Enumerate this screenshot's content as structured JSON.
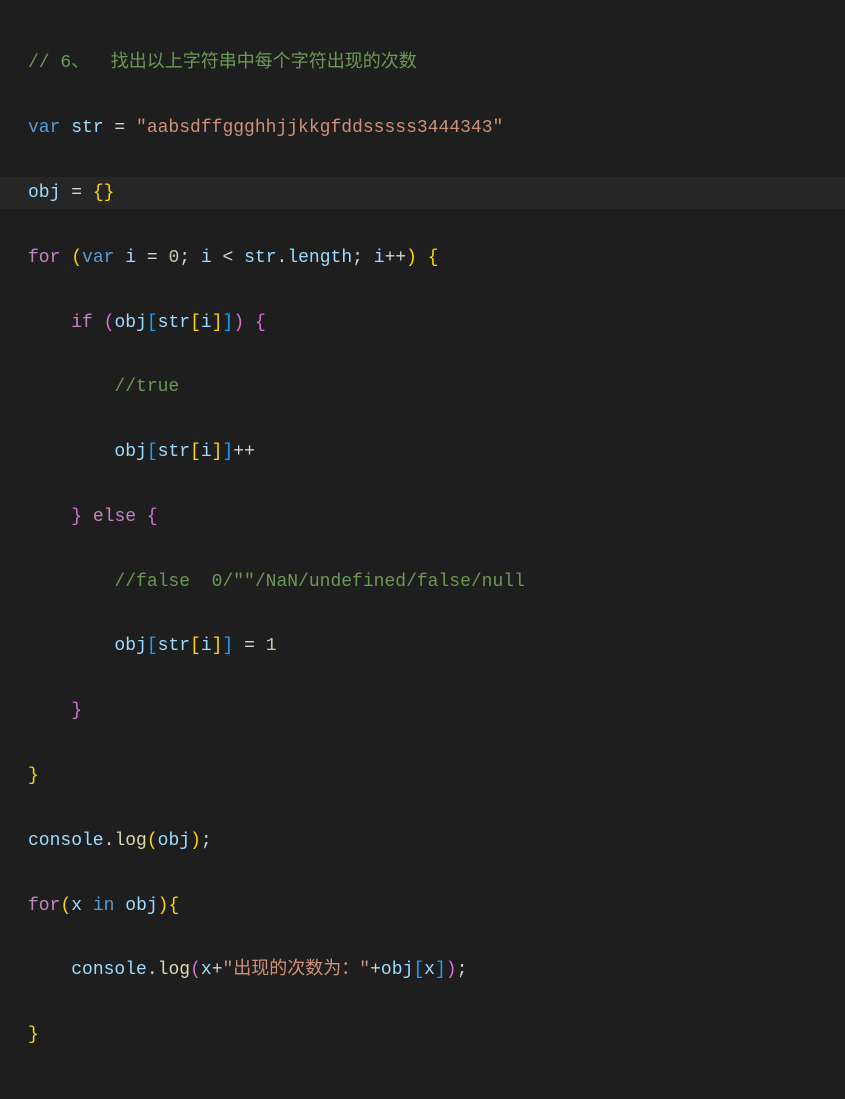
{
  "code": {
    "line1": {
      "comment": "// 6、  找出以上字符串中每个字符出现的次数"
    },
    "line2": {
      "kw_var": "var",
      "sp": " ",
      "str_var": "str",
      "eq": " = ",
      "string": "\"aabsdffggghhjjkkgfddsssss3444343\""
    },
    "line3": {
      "obj": "obj",
      "eq": " = ",
      "brace": "{}"
    },
    "line4": {
      "for": "for",
      "sp": " ",
      "op": "(",
      "kw_var": "var",
      "sp2": " ",
      "i": "i",
      "eq": " = ",
      "zero": "0",
      "semi": "; ",
      "i2": "i",
      "lt": " < ",
      "str": "str",
      "dot": ".",
      "len": "length",
      "semi2": "; ",
      "i3": "i",
      "inc": "++",
      "cp": ") ",
      "ob": "{"
    },
    "line5": {
      "indent": "    ",
      "if": "if",
      "sp": " ",
      "op": "(",
      "obj": "obj",
      "ob": "[",
      "str": "str",
      "ob2": "[",
      "i": "i",
      "cb2": "]",
      "cb": "]",
      "cp": ") ",
      "brace": "{"
    },
    "line6": {
      "indent": "        ",
      "comment": "//true"
    },
    "line7": {
      "indent": "        ",
      "obj": "obj",
      "ob": "[",
      "str": "str",
      "ob2": "[",
      "i": "i",
      "cb2": "]",
      "cb": "]",
      "inc": "++"
    },
    "line8": {
      "indent": "    ",
      "cb": "}",
      "sp": " ",
      "else": "else",
      "sp2": " ",
      "ob": "{"
    },
    "line9": {
      "indent": "        ",
      "comment": "//false  0/\"\"/NaN/undefined/false/null"
    },
    "line10": {
      "indent": "        ",
      "obj": "obj",
      "ob": "[",
      "str": "str",
      "ob2": "[",
      "i": "i",
      "cb2": "]",
      "cb": "]",
      "eq": " = ",
      "one": "1"
    },
    "line11": {
      "indent": "    ",
      "cb": "}"
    },
    "line12": {
      "cb": "}"
    },
    "line13": {
      "console": "console",
      "dot": ".",
      "log": "log",
      "op": "(",
      "obj": "obj",
      "cp": ")",
      "semi": ";"
    },
    "line14": {
      "for": "for",
      "op": "(",
      "x": "x",
      "sp": " ",
      "in": "in",
      "sp2": " ",
      "obj": "obj",
      "cp": ")",
      "ob": "{"
    },
    "line15": {
      "indent": "    ",
      "console": "console",
      "dot": ".",
      "log": "log",
      "op": "(",
      "x": "x",
      "plus": "+",
      "str1": "\"出现的次数为：\"",
      "plus2": "+",
      "obj": "obj",
      "ob": "[",
      "x2": "x",
      "cb": "]",
      "cp": ")",
      "semi": ";"
    },
    "line16": {
      "cb": "}"
    }
  }
}
